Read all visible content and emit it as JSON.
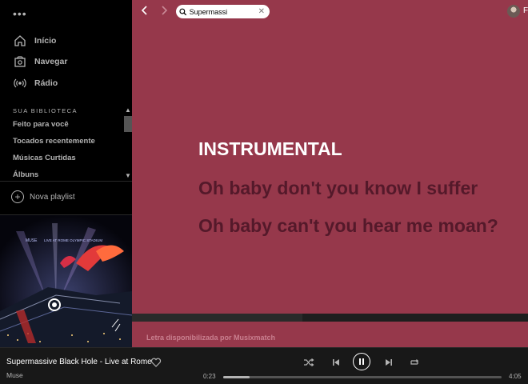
{
  "sidebar": {
    "menu_dots": "•••",
    "nav": [
      {
        "label": "Início",
        "icon": "home-icon"
      },
      {
        "label": "Navegar",
        "icon": "browse-icon"
      },
      {
        "label": "Rádio",
        "icon": "radio-icon"
      }
    ],
    "library_heading": "SUA BIBLIOTECA",
    "library_items": [
      "Feito para você",
      "Tocados recentemente",
      "Músicas Curtidas",
      "Álbuns"
    ],
    "new_playlist_label": "Nova playlist"
  },
  "album_art": {
    "band": "MUSE",
    "subtitle": "LIVE AT ROME OLYMPIC STADIUM"
  },
  "topbar": {
    "search_value": "Supermassi",
    "user_name": "Fe"
  },
  "lyrics": {
    "current": "INSTRUMENTAL",
    "next": [
      "Oh baby don't you know I suffer",
      "Oh baby can't you hear me moan?"
    ],
    "provider": "Letra disponibilizada por Musixmatch",
    "progress": 0.43
  },
  "player": {
    "track_title": "Supermassive Black Hole - Live at Rome",
    "artist": "Muse",
    "elapsed": "0:23",
    "total": "4:05",
    "progress": 0.094
  },
  "colors": {
    "main_bg": "#96384b",
    "upcoming_lyric": "#54192a",
    "sidebar_bg": "#000000",
    "player_bg": "#181818"
  }
}
